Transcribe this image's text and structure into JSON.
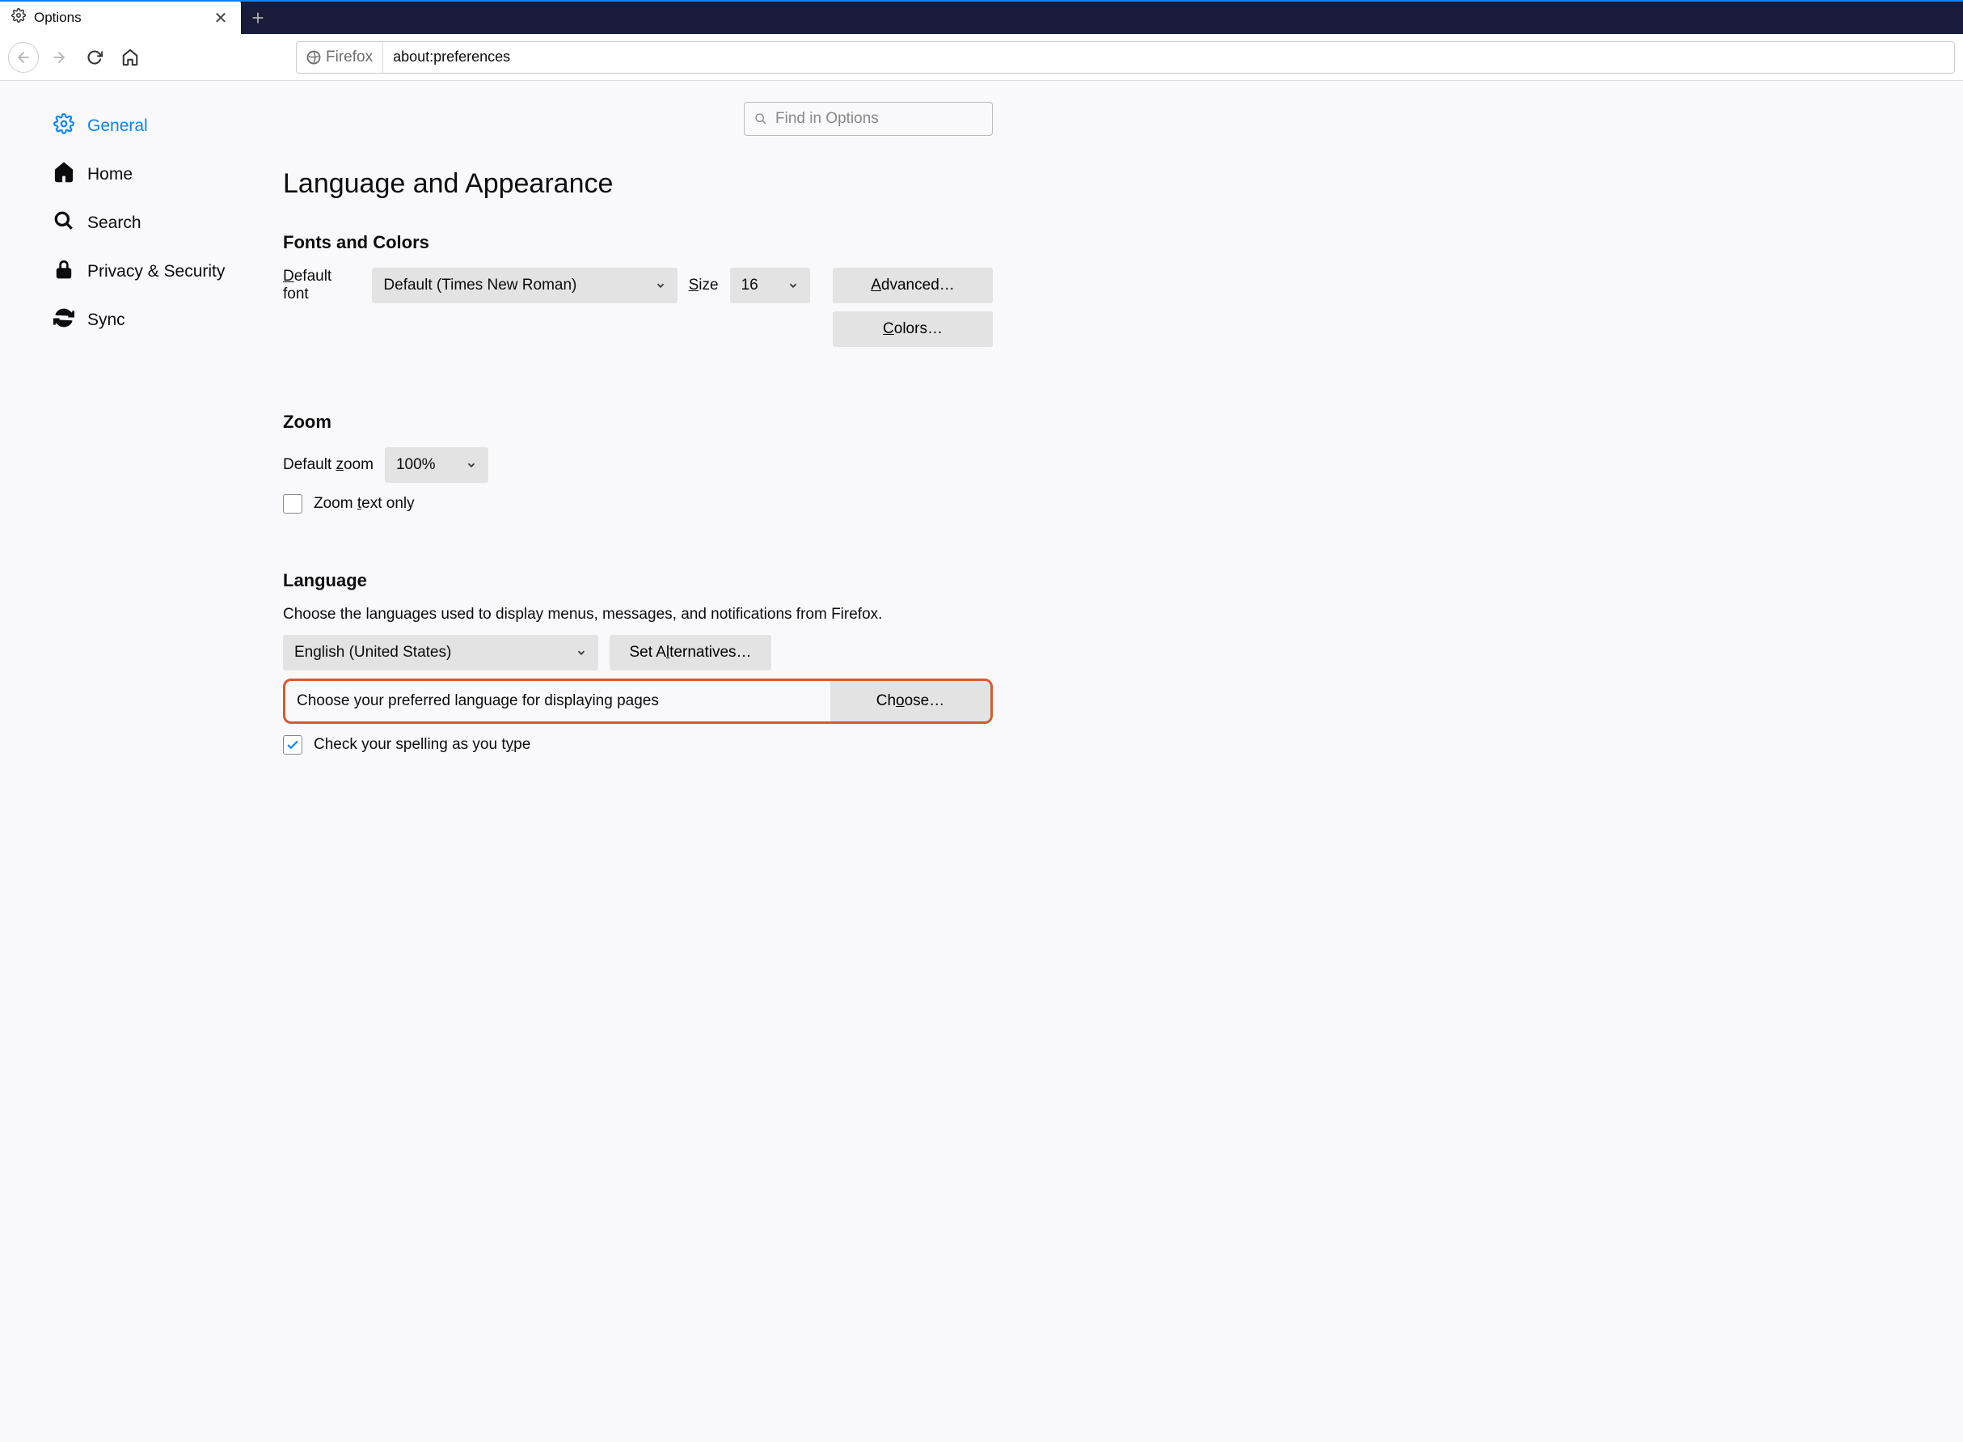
{
  "tab": {
    "title": "Options"
  },
  "urlbar": {
    "identity": "Firefox",
    "url": "about:preferences"
  },
  "search": {
    "placeholder": "Find in Options"
  },
  "sidebar": {
    "items": [
      {
        "label": "General",
        "icon": "gear"
      },
      {
        "label": "Home",
        "icon": "home"
      },
      {
        "label": "Search",
        "icon": "search"
      },
      {
        "label": "Privacy & Security",
        "icon": "lock"
      },
      {
        "label": "Sync",
        "icon": "sync"
      }
    ]
  },
  "headings": {
    "page": "Language and Appearance",
    "fonts": "Fonts and Colors",
    "zoom": "Zoom",
    "language": "Language"
  },
  "fonts": {
    "defaultFontLabelPre": "D",
    "defaultFontLabelPost": "efault font",
    "defaultFontValue": "Default (Times New Roman)",
    "sizeLabelPre": "S",
    "sizeLabelPost": "ize",
    "sizeValue": "16",
    "advancedPre": "A",
    "advancedPost": "dvanced…",
    "colorsPre": "C",
    "colorsPost": "olors…"
  },
  "zoom": {
    "defaultZoomLabelPre": "Default ",
    "defaultZoomLabelUnder": "z",
    "defaultZoomLabelPost": "oom",
    "value": "100%",
    "textOnlyPre": "Zoom ",
    "textOnlyUnder": "t",
    "textOnlyPost": "ext only"
  },
  "language": {
    "desc": "Choose the languages used to display menus, messages, and notifications from Firefox.",
    "uiLang": "English (United States)",
    "setAltPre": "Set A",
    "setAltUnder": "l",
    "setAltPost": "ternatives…",
    "prefRowText": "Choose your preferred language for displaying pages",
    "choosePre": "Ch",
    "chooseUnder": "o",
    "choosePost": "ose…",
    "spellPre": "Check your spelling as you t",
    "spellUnder": "y",
    "spellPost": "pe"
  }
}
